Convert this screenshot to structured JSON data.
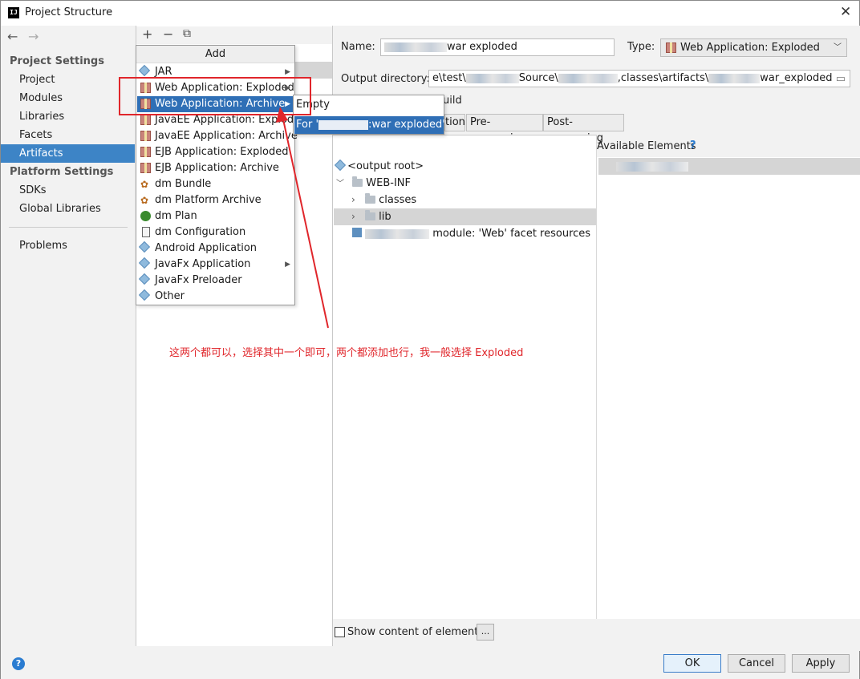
{
  "window": {
    "title": "Project Structure",
    "app_icon_text": "IJ"
  },
  "nav": {
    "back": "←",
    "forward": "→"
  },
  "sidebar": {
    "project_settings_header": "Project Settings",
    "project_items": [
      {
        "label": "Project"
      },
      {
        "label": "Modules"
      },
      {
        "label": "Libraries"
      },
      {
        "label": "Facets"
      },
      {
        "label": "Artifacts"
      }
    ],
    "platform_settings_header": "Platform Settings",
    "platform_items": [
      {
        "label": "SDKs"
      },
      {
        "label": "Global Libraries"
      }
    ],
    "problems_label": "Problems"
  },
  "toolbar": {
    "add": "+",
    "remove": "−",
    "copy": "⧉"
  },
  "add_menu": {
    "header": "Add",
    "items": [
      {
        "label": "JAR",
        "icon": "diamond-icon",
        "submenu": true
      },
      {
        "label": "Web Application: Exploded",
        "icon": "package-icon",
        "submenu": true
      },
      {
        "label": "Web Application: Archive",
        "icon": "package-icon",
        "submenu": true
      },
      {
        "label": "JavaEE Application: Exploded",
        "icon": "package-icon",
        "submenu": false
      },
      {
        "label": "JavaEE Application: Archive",
        "icon": "package-icon",
        "submenu": false
      },
      {
        "label": "EJB Application: Exploded",
        "icon": "package-icon",
        "submenu": false
      },
      {
        "label": "EJB Application: Archive",
        "icon": "package-icon",
        "submenu": false
      },
      {
        "label": "dm Bundle",
        "icon": "bundle-icon",
        "submenu": false
      },
      {
        "label": "dm Platform Archive",
        "icon": "bundle-icon",
        "submenu": false
      },
      {
        "label": "dm Plan",
        "icon": "plan-icon",
        "submenu": false
      },
      {
        "label": "dm Configuration",
        "icon": "config-icon",
        "submenu": false
      },
      {
        "label": "Android Application",
        "icon": "diamond-icon",
        "submenu": false
      },
      {
        "label": "JavaFx Application",
        "icon": "diamond-icon",
        "submenu": true
      },
      {
        "label": "JavaFx Preloader",
        "icon": "diamond-icon",
        "submenu": false
      },
      {
        "label": "Other",
        "icon": "diamond-icon",
        "submenu": false
      }
    ]
  },
  "submenu": {
    "empty": "Empty",
    "for_prefix": "For '",
    "for_suffix": ":war exploded'"
  },
  "form": {
    "name_label": "Name:",
    "name_value_suffix": "war exploded",
    "type_label": "Type:",
    "type_value": "Web Application: Exploded",
    "output_label": "Output directory:",
    "output_seg1": "e\\test\\",
    "output_seg2": "Source\\",
    "output_seg3": ",classes\\artifacts\\",
    "output_seg4": "war_exploded",
    "include_build_partial": "uild"
  },
  "tabs": [
    {
      "label": "tion"
    },
    {
      "label": "Pre-processing"
    },
    {
      "label": "Post-processing"
    }
  ],
  "tree": {
    "output_root": "<output root>",
    "web_inf": "WEB-INF",
    "classes": "classes",
    "lib": "lib",
    "facet_resources_suffix": " module: 'Web' facet resources"
  },
  "available": {
    "label": "Available Elements",
    "help": "?"
  },
  "bottom": {
    "show_content": "Show content of elements",
    "more": "...",
    "ok": "OK",
    "cancel": "Cancel",
    "apply": "Apply",
    "help": "?"
  },
  "annotation": {
    "text": "这两个都可以，选择其中一个即可，两个都添加也行，我一般选择 Exploded",
    "color": "#e0262b"
  },
  "colors": {
    "selection": "#3d84c6",
    "menu_highlight": "#2f6fb6",
    "annotation_red": "#e0262b"
  }
}
